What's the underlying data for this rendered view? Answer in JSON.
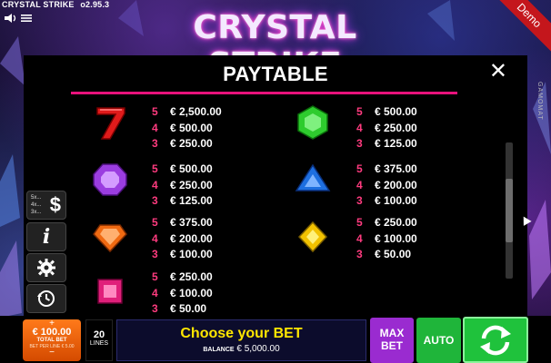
{
  "header": {
    "game_title": "CRYSTAL STRIKE",
    "version": "o2.95.3",
    "logo_text": "CRYSTAL STRIKE",
    "demo_label": "Demo",
    "side_label": "GAMOMAT"
  },
  "paytable": {
    "title": "PAYTABLE",
    "close_symbol": "✕",
    "symbols": [
      {
        "name": "red-seven",
        "color": "#e01b1b",
        "pays": [
          {
            "count": "5",
            "amount": "€ 2,500.00"
          },
          {
            "count": "4",
            "amount": "€ 500.00"
          },
          {
            "count": "3",
            "amount": "€ 250.00"
          }
        ]
      },
      {
        "name": "green-gem",
        "color": "#2ecc2e",
        "pays": [
          {
            "count": "5",
            "amount": "€ 500.00"
          },
          {
            "count": "4",
            "amount": "€ 250.00"
          },
          {
            "count": "3",
            "amount": "€ 125.00"
          }
        ]
      },
      {
        "name": "purple-gem",
        "color": "#9b3de0",
        "pays": [
          {
            "count": "5",
            "amount": "€ 500.00"
          },
          {
            "count": "4",
            "amount": "€ 250.00"
          },
          {
            "count": "3",
            "amount": "€ 125.00"
          }
        ]
      },
      {
        "name": "blue-gem",
        "color": "#1e6fe0",
        "pays": [
          {
            "count": "5",
            "amount": "€ 375.00"
          },
          {
            "count": "4",
            "amount": "€ 200.00"
          },
          {
            "count": "3",
            "amount": "€ 100.00"
          }
        ]
      },
      {
        "name": "orange-gem",
        "color": "#f06a12",
        "pays": [
          {
            "count": "5",
            "amount": "€ 375.00"
          },
          {
            "count": "4",
            "amount": "€ 200.00"
          },
          {
            "count": "3",
            "amount": "€ 100.00"
          }
        ]
      },
      {
        "name": "yellow-gem",
        "color": "#f2c200",
        "pays": [
          {
            "count": "5",
            "amount": "€ 250.00"
          },
          {
            "count": "4",
            "amount": "€ 100.00"
          },
          {
            "count": "3",
            "amount": "€ 50.00"
          }
        ]
      },
      {
        "name": "pink-gem",
        "color": "#e0207a",
        "pays": [
          {
            "count": "5",
            "amount": "€ 250.00"
          },
          {
            "count": "4",
            "amount": "€ 100.00"
          },
          {
            "count": "3",
            "amount": "€ 50.00"
          }
        ]
      }
    ]
  },
  "side_buttons": {
    "multipliers": [
      "5x...",
      "4x...",
      "3x..."
    ],
    "paytable_icon": "dollar-icon",
    "info_icon": "info-icon",
    "settings_icon": "gear-icon",
    "history_icon": "history-icon"
  },
  "bottom_bar": {
    "plus": "+",
    "bet_value": "€ 100.00",
    "bet_label": "TOTAL BET",
    "bet_per_line": "BET PER LINE € 5.00",
    "minus": "−",
    "lines_value": "20",
    "lines_label": "LINES",
    "message": "Choose your BET",
    "balance_label": "BALANCE",
    "balance_value": "€ 5,000.00",
    "max_bet_line1": "MAX",
    "max_bet_line2": "BET",
    "auto_label": "AUTO",
    "spin_icon": "spin-arrows-icon"
  },
  "colors": {
    "accent_pink": "#e8127c",
    "count_pink": "#ff3b7f",
    "bet_orange": "#ff7a1a",
    "max_bet_purple": "#9a2bd0",
    "auto_green": "#1fb53a",
    "message_yellow": "#ffe600"
  }
}
